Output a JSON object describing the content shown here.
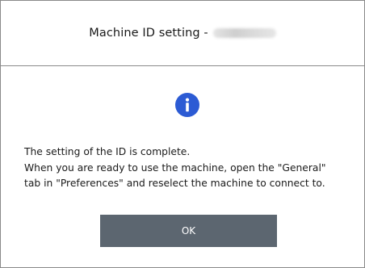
{
  "dialog": {
    "title_prefix": "Machine ID setting -",
    "message_lines": [
      "The setting of the ID is complete.",
      "When you are ready to use the machine, open the \"General\"",
      "tab in \"Preferences\" and reselect the machine to connect to."
    ],
    "ok_label": "OK",
    "icon": "info-icon",
    "colors": {
      "icon": "#2c5bd4",
      "button": "#5c6670",
      "border": "#8a8a8a"
    }
  }
}
